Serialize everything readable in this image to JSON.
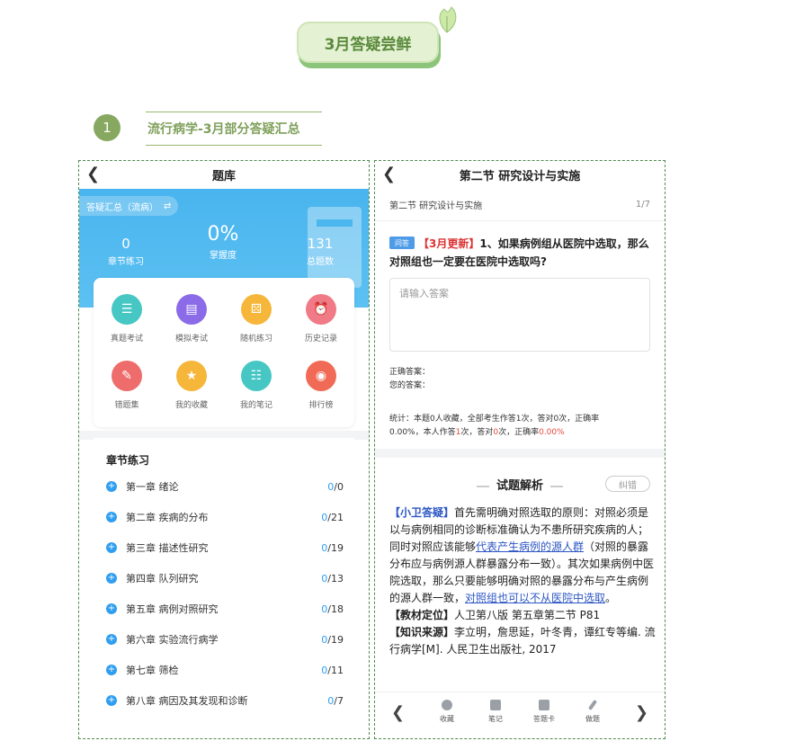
{
  "banner": {
    "title": "3月答疑尝鲜"
  },
  "section": {
    "number": "1",
    "title": "流行病学-3月部分答疑汇总"
  },
  "left_phone": {
    "nav_title": "题库",
    "hero": {
      "pill_label": "答疑汇总（流病）",
      "stats": [
        {
          "value": "0",
          "label": "章节练习"
        },
        {
          "value": "0%",
          "label": "掌握度"
        },
        {
          "value": "131",
          "label": "总题数"
        }
      ]
    },
    "grid": [
      {
        "label": "真题考试",
        "color": "#46c7c4",
        "icon": "list-icon"
      },
      {
        "label": "模拟考试",
        "color": "#8b6be8",
        "icon": "document-icon"
      },
      {
        "label": "随机练习",
        "color": "#f6b63a",
        "icon": "dice-icon"
      },
      {
        "label": "历史记录",
        "color": "#f07a86",
        "icon": "history-icon"
      },
      {
        "label": "错题集",
        "color": "#ee6c6c",
        "icon": "clipboard-icon"
      },
      {
        "label": "我的收藏",
        "color": "#f6b63a",
        "icon": "star-icon"
      },
      {
        "label": "我的笔记",
        "color": "#46c7c4",
        "icon": "notebook-icon"
      },
      {
        "label": "排行榜",
        "color": "#f06a56",
        "icon": "medal-icon"
      }
    ],
    "chapters_heading": "章节练习",
    "chapters": [
      {
        "name": "第一章 绪论",
        "done": "0",
        "total": "/0"
      },
      {
        "name": "第二章 疾病的分布",
        "done": "0",
        "total": "/21"
      },
      {
        "name": "第三章 描述性研究",
        "done": "0",
        "total": "/19"
      },
      {
        "name": "第四章 队列研究",
        "done": "0",
        "total": "/13"
      },
      {
        "name": "第五章 病例对照研究",
        "done": "0",
        "total": "/18"
      },
      {
        "name": "第六章 实验流行病学",
        "done": "0",
        "total": "/19"
      },
      {
        "name": "第七章 筛检",
        "done": "0",
        "total": "/11"
      },
      {
        "name": "第八章 病因及其发现和诊断",
        "done": "0",
        "total": "/7"
      }
    ]
  },
  "right_phone": {
    "nav_title": "第二节 研究设计与实施",
    "sub_title": "第二节 研究设计与实施",
    "page": "1/7",
    "q_tag": "问答",
    "q_update": "【3月更新】",
    "q_text": "1、如果病例组从医院中选取，那么对照组也一定要在医院中选取吗?",
    "answer_placeholder": "请输入答案",
    "correct_label": "正确答案：",
    "your_label": "您的答案：",
    "stats": {
      "line1": "统计：本题0人收藏，全部考生作答1次，答对0次，正确率",
      "line2_a": "0.00%，本人作答",
      "line2_b": "1",
      "line2_c": "次，答对",
      "line2_d": "0",
      "line2_e": "次，正确率",
      "line2_f": "0.00%"
    },
    "analysis_title": "试题解析",
    "error_button": "纠错",
    "analysis": {
      "tag1": "【小卫答疑】",
      "p1a": "首先需明确对照选取的原则：对照必须是以与病例相同的诊断标准确认为不患所研究疾病的人；同时对照应该能够",
      "p1_link": "代表产生病例的源人群",
      "p1b": "（对照的暴露分布应与病例源人群暴露分布一致）。其次如果病例中医院选取，那么只要能够明确对照的暴露分布与产生病例的源人群一致，",
      "p1_link2": "对照组也可以不从医院中选取",
      "p1c": "。",
      "tag2": "【教材定位】",
      "p2": "人卫第八版 第五章第二节 P81",
      "tag3": "【知识来源】",
      "p3": "李立明，詹思延，叶冬青，谭红专等编. 流行病学[M]. 人民卫生出版社, 2017"
    },
    "toolbar": [
      {
        "label": "收藏",
        "icon": "star-icon"
      },
      {
        "label": "笔记",
        "icon": "note-icon"
      },
      {
        "label": "答题卡",
        "icon": "grid-icon"
      },
      {
        "label": "做题",
        "icon": "pencil-icon"
      }
    ]
  }
}
